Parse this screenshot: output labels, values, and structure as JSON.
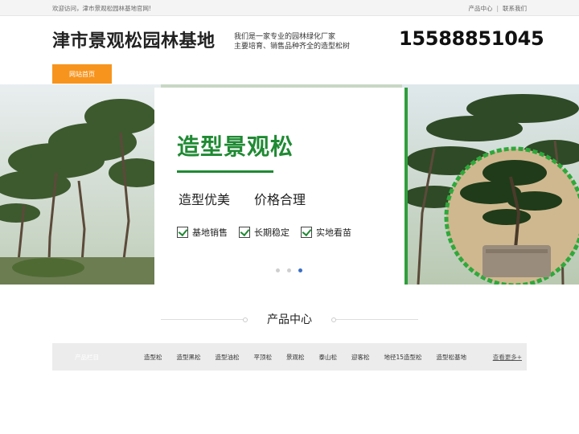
{
  "topbar": {
    "welcome": "欢迎访问，津市景观松园林基地官网!",
    "links": [
      "产品中心",
      "联系我们"
    ],
    "separator": "|"
  },
  "header": {
    "site_name": "津市景观松园林基地",
    "slogan_line1": "我们是一家专业的园林绿化厂家",
    "slogan_line2": "主要培育、销售品种齐全的造型松树",
    "phone": "15588851045"
  },
  "nav": {
    "home_label": "网站首页",
    "accent_color": "#f7941d"
  },
  "banner": {
    "title": "造型景观松",
    "features": [
      "造型优美",
      "价格合理"
    ],
    "checks": [
      "基地销售",
      "长期稳定",
      "实地看苗"
    ],
    "brand_color": "#1f8a33",
    "slide_count": 3,
    "active_slide": 3
  },
  "products": {
    "section_title": "产品中心",
    "category_head": "产品栏目",
    "categories": [
      "造型松",
      "造型黑松",
      "造型油松",
      "平顶松",
      "景观松",
      "泰山松",
      "迎客松",
      "地径15造型松",
      "造型松基地"
    ],
    "more": "查看更多+"
  }
}
